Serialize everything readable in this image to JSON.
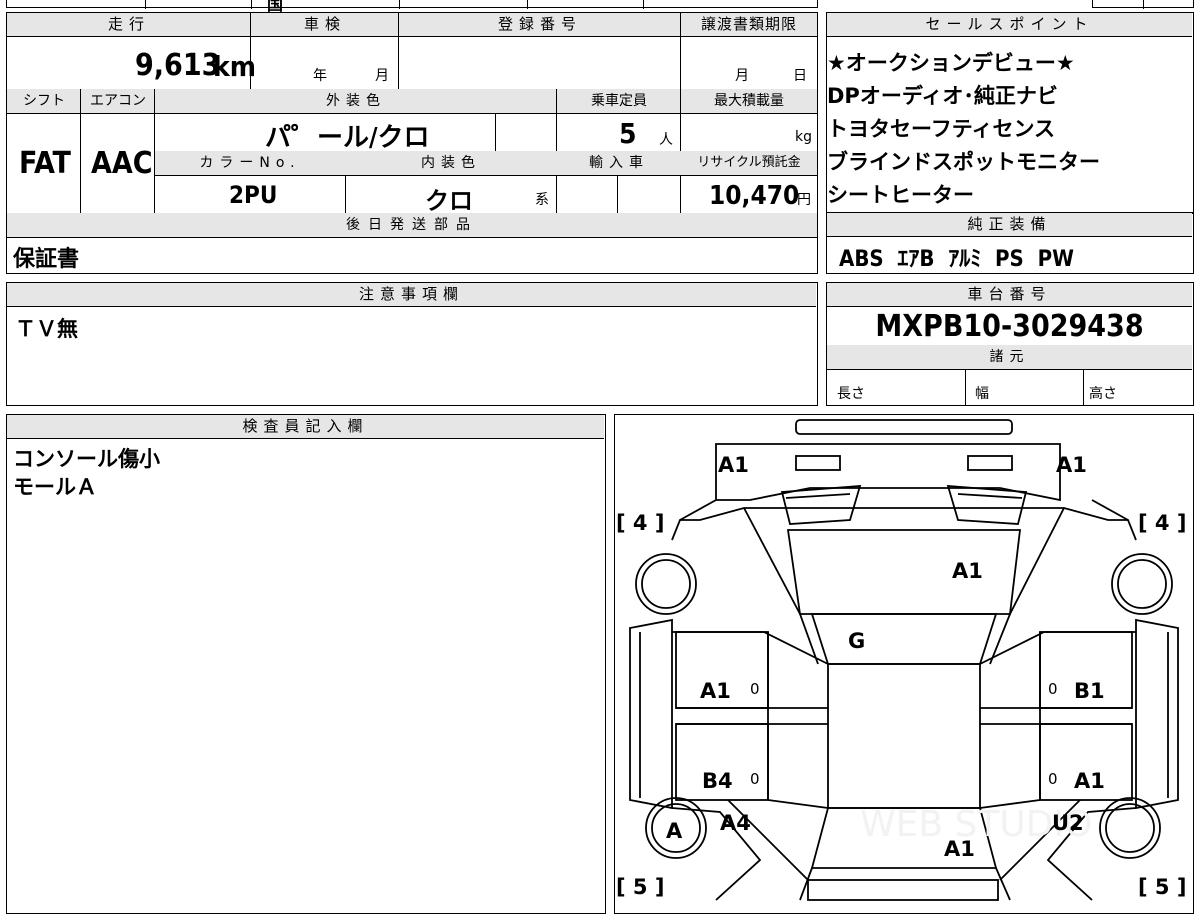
{
  "top_strip": {
    "text_a": "国",
    "text_b": ""
  },
  "mileage": {
    "label": "走行",
    "value": "9,613",
    "unit": "km"
  },
  "shaken": {
    "label": "車検",
    "year_unit": "年",
    "month_unit": "月"
  },
  "registration": {
    "label": "登録番号",
    "value": ""
  },
  "transfer_deadline": {
    "label": "譲渡書類期限",
    "month_unit": "月",
    "day_unit": "日"
  },
  "shift": {
    "label": "シフト",
    "value": "FAT"
  },
  "aircon": {
    "label": "エアコン",
    "value": "AAC"
  },
  "exterior_color": {
    "label": "外装色",
    "value": "パ゜ール/クロ"
  },
  "capacity": {
    "label": "乗車定員",
    "value": "5",
    "unit": "人"
  },
  "max_load": {
    "label": "最大積載量",
    "unit": "kg"
  },
  "color_no": {
    "label": "カラーNo.",
    "value": "2PU"
  },
  "interior_color": {
    "label": "内装色",
    "value": "クロ",
    "suffix": "系"
  },
  "import": {
    "label": "輸入車"
  },
  "recycle_fee": {
    "label": "リサイクル預託金",
    "value": "10,470",
    "unit": "円"
  },
  "later_parts": {
    "label": "後日発送部品",
    "value": "保証書"
  },
  "sales_points": {
    "label": "セールスポイント",
    "items": [
      "★オークションデビュー★",
      "DPオーディオ･純正ナビ",
      "トヨタセーフティセンス",
      "ブラインドスポットモニター",
      "シートヒーター"
    ]
  },
  "equipment": {
    "label": "純正装備",
    "value": "ABS  ｴｱB  ｱﾙﾐ  PS  PW"
  },
  "notes": {
    "label": "注意事項欄",
    "value": "ＴＶ無"
  },
  "chassis": {
    "label": "車台番号",
    "value": "MXPB10-3029438"
  },
  "specs": {
    "label": "諸元",
    "length": "長さ",
    "width": "幅",
    "height": "高さ"
  },
  "inspector": {
    "label": "検査員記入欄",
    "lines": [
      "コンソール傷小",
      "モールＡ"
    ]
  },
  "diagram": {
    "marks": [
      "A1",
      "A1",
      "A1",
      "G",
      "A1",
      "B1",
      "B4",
      "A1",
      "A4",
      "U2",
      "A1",
      "A"
    ],
    "tire_fl": "[ 4 ]",
    "tire_fr": "[ 4 ]",
    "tire_rl": "[ 5 ]",
    "tire_rr": "[ 5 ]",
    "zero": "0",
    "watermark": "WEB STUDIO"
  }
}
